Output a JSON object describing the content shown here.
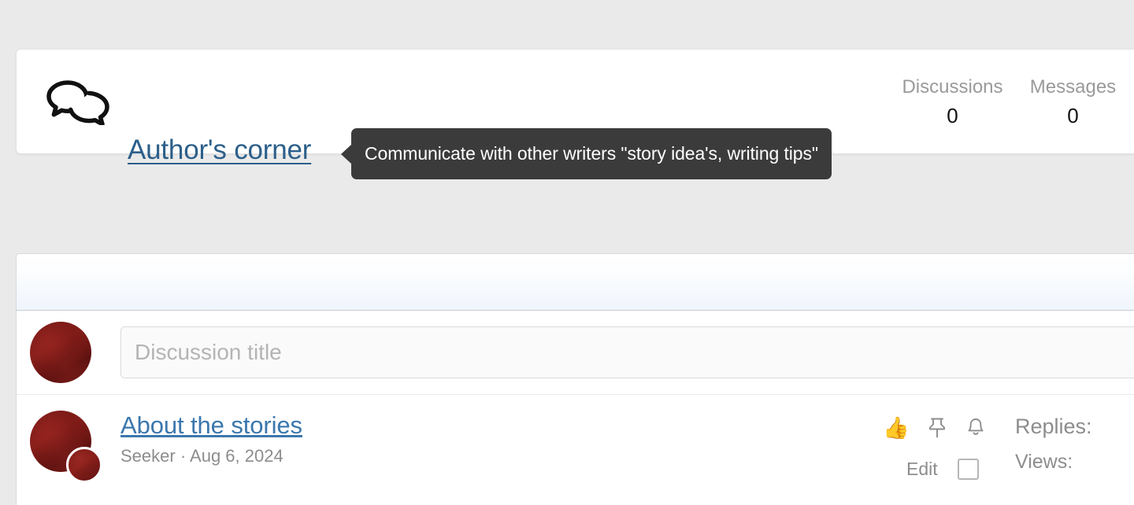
{
  "page": {
    "background_color": "#eaeaea"
  },
  "forum_header": {
    "icon_name": "speech-bubbles-icon",
    "title": "Author's corner",
    "title_link_color": "#2c5f8a",
    "tooltip": {
      "text": "Communicate with other writers \"story idea's, writing tips\"",
      "background_color": "#3b3b3b",
      "text_color": "#ffffff"
    },
    "stats": [
      {
        "label": "Discussions",
        "value": "0"
      },
      {
        "label": "Messages",
        "value": "0"
      }
    ]
  },
  "discussion_panel": {
    "header_gradient_from": "#ffffff",
    "header_gradient_to": "#f0f5fb",
    "new_discussion": {
      "avatar_name": "user-avatar",
      "input_placeholder": "Discussion title",
      "input_value": ""
    },
    "discussions": [
      {
        "avatar_name": "author-avatar",
        "mini_avatar_name": "last-poster-avatar",
        "title": "About the stories",
        "title_color": "#3b77ad",
        "author": "Seeker",
        "separator": "·",
        "date": "Aug 6, 2024",
        "meta": "Seeker · Aug 6, 2024",
        "actions": {
          "like_icon": "thumbs-up-icon",
          "like_glyph": "👍",
          "pin_icon": "pin-icon",
          "bell_icon": "bell-icon",
          "edit_label": "Edit",
          "checkbox_checked": false
        },
        "counts": [
          {
            "label": "Replies:",
            "value": ""
          },
          {
            "label": "Views:",
            "value": ""
          }
        ]
      }
    ]
  }
}
